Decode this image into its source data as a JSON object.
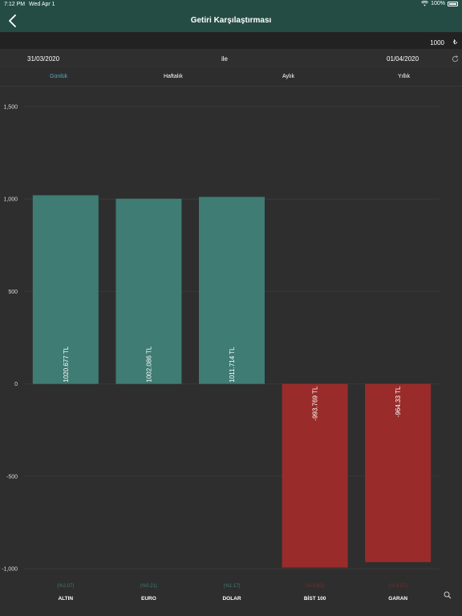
{
  "status_bar": {
    "time": "7:12 PM",
    "date": "Wed Apr 1",
    "battery": "100%"
  },
  "nav": {
    "title": "Getiri Karşılaştırması",
    "back_icon": "chevron-left-icon"
  },
  "amount": {
    "value": "1000",
    "currency": "₺"
  },
  "date_range": {
    "start": "31/03/2020",
    "connector": "ile",
    "end": "01/04/2020",
    "refresh_icon": "refresh-icon"
  },
  "tabs": [
    {
      "label": "Günlük",
      "active": true
    },
    {
      "label": "Haftalık",
      "active": false
    },
    {
      "label": "Aylık",
      "active": false
    },
    {
      "label": "Yıllık",
      "active": false
    }
  ],
  "colors": {
    "positive": "#3f7c74",
    "negative": "#992c2b",
    "positive_text": "#3f7c74",
    "negative_text": "#7a2e2d",
    "accent": "#5aa7bf"
  },
  "chart_data": {
    "type": "bar",
    "categories": [
      "ALTIN",
      "EURO",
      "DOLAR",
      "BİST 100",
      "GARAN"
    ],
    "values": [
      1020.677,
      1002.086,
      1011.714,
      -993.769,
      -964.33
    ],
    "value_labels": [
      "1020.677 TL",
      "1002.086 TL",
      "1011.714 TL",
      "-993.769 TL",
      "-964.33 TL"
    ],
    "percent_labels": [
      "(%2.07)",
      "(%0.21)",
      "(%1.17)",
      "(%-0.62)",
      "(%-3.57)"
    ],
    "ylim": [
      -1000,
      1500
    ],
    "yticks": [
      -1000,
      -500,
      0,
      500,
      1000,
      1500
    ],
    "ytick_labels": [
      "-1,000",
      "-500",
      "0",
      "500",
      "1,000",
      "1,500"
    ],
    "grid": true
  },
  "search_icon": "search-icon"
}
